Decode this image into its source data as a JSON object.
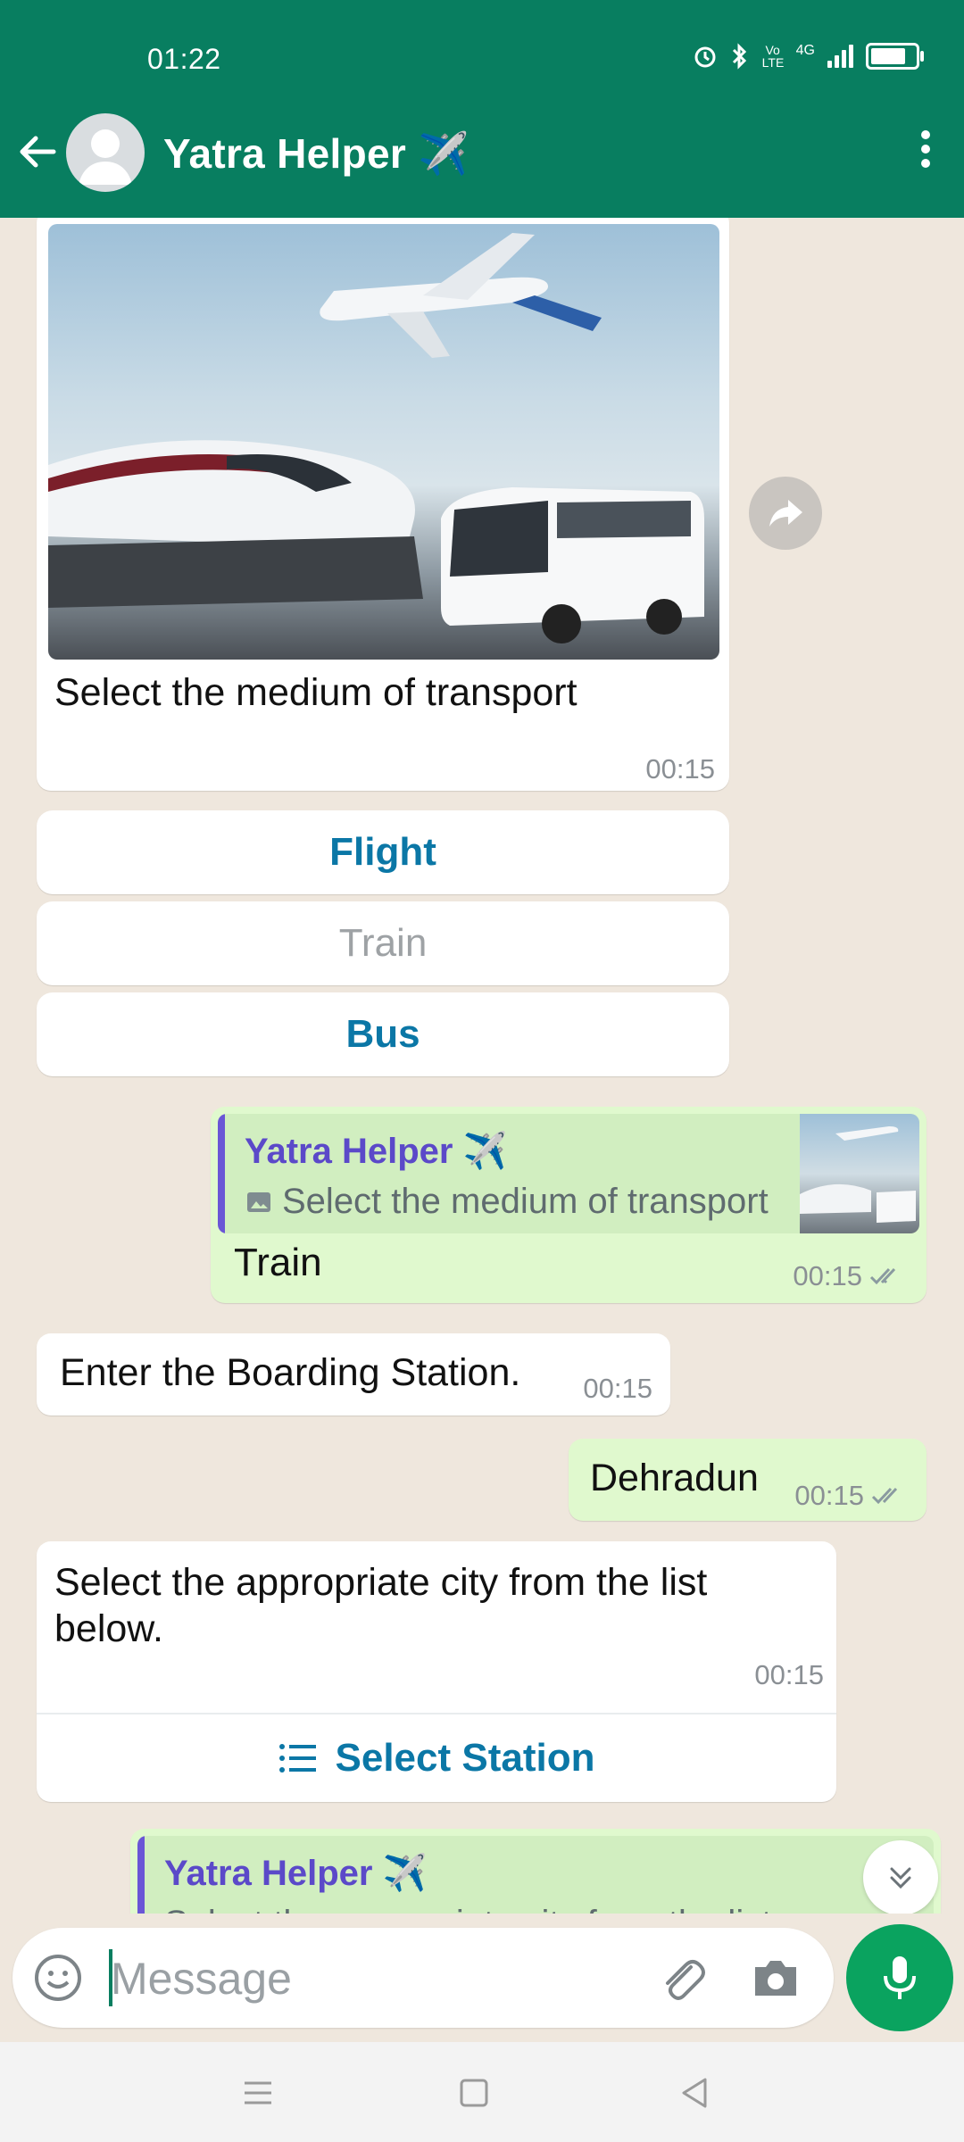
{
  "status_bar": {
    "time": "01:22",
    "network": "4G",
    "volte": "Vo LTE"
  },
  "header": {
    "title": "Yatra Helper ✈️",
    "bg_color": "#087e60"
  },
  "messages": {
    "image_message": {
      "caption": "Select the medium of transport",
      "time": "00:15",
      "buttons": [
        {
          "label": "Flight",
          "state": "active"
        },
        {
          "label": "Train",
          "state": "disabled"
        },
        {
          "label": "Bus",
          "state": "active"
        }
      ]
    },
    "reply_train": {
      "quote_name": "Yatra Helper ✈️",
      "quote_text": "Select the medium of transport",
      "text": "Train",
      "time": "00:15"
    },
    "boarding": {
      "text": "Enter the Boarding Station.",
      "time": "00:15"
    },
    "dehradun": {
      "text": "Dehradun",
      "time": "00:15"
    },
    "city_list": {
      "text": "Select the appropriate city from the list below.",
      "time": "00:15",
      "action_label": "Select Station"
    },
    "partial_reply": {
      "quote_name": "Yatra Helper ✈️",
      "quote_text": "Select the appropriate city from the list"
    }
  },
  "composer": {
    "placeholder": "Message"
  },
  "icons": {
    "read_receipt": "double-check-icon",
    "forward": "forward-icon",
    "list": "list-icon"
  }
}
